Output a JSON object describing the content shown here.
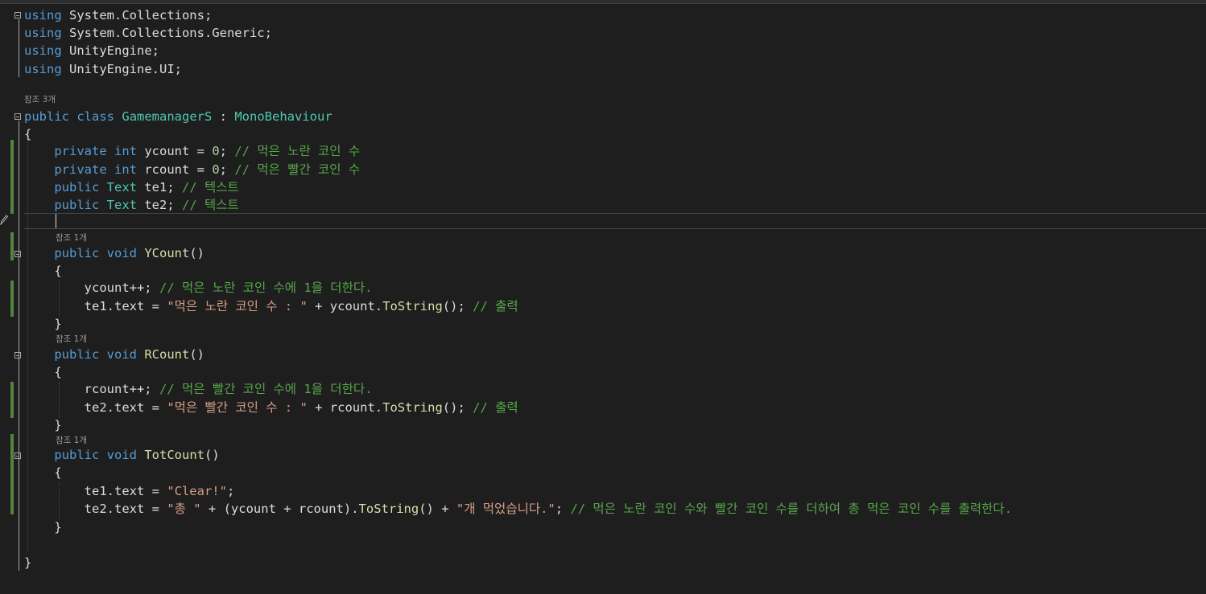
{
  "code": {
    "lines": [
      {
        "segments": [
          {
            "t": "using",
            "c": "kw"
          },
          {
            "t": " System.Collections;",
            "c": "pl"
          }
        ]
      },
      {
        "segments": [
          {
            "t": "using",
            "c": "kw"
          },
          {
            "t": " System.Collections.Generic;",
            "c": "pl"
          }
        ]
      },
      {
        "segments": [
          {
            "t": "using",
            "c": "kw"
          },
          {
            "t": " UnityEngine;",
            "c": "pl"
          }
        ]
      },
      {
        "segments": [
          {
            "t": "using",
            "c": "kw"
          },
          {
            "t": " UnityEngine.UI;",
            "c": "pl"
          }
        ]
      },
      {
        "segments": [
          {
            "t": "public",
            "c": "kw"
          },
          {
            "t": " ",
            "c": "pl"
          },
          {
            "t": "class",
            "c": "kw"
          },
          {
            "t": " ",
            "c": "pl"
          },
          {
            "t": "GamemanagerS",
            "c": "ty"
          },
          {
            "t": " : ",
            "c": "pl"
          },
          {
            "t": "MonoBehaviour",
            "c": "ty"
          }
        ]
      },
      {
        "segments": [
          {
            "t": "{",
            "c": "pl"
          }
        ]
      },
      {
        "segments": [
          {
            "t": "    ",
            "c": "pl"
          },
          {
            "t": "private",
            "c": "kw"
          },
          {
            "t": " ",
            "c": "pl"
          },
          {
            "t": "int",
            "c": "kw"
          },
          {
            "t": " ycount = ",
            "c": "pl"
          },
          {
            "t": "0",
            "c": "nu"
          },
          {
            "t": "; ",
            "c": "pl"
          },
          {
            "t": "// 먹은 노란 코인 수",
            "c": "cm"
          }
        ]
      },
      {
        "segments": [
          {
            "t": "    ",
            "c": "pl"
          },
          {
            "t": "private",
            "c": "kw"
          },
          {
            "t": " ",
            "c": "pl"
          },
          {
            "t": "int",
            "c": "kw"
          },
          {
            "t": " rcount = ",
            "c": "pl"
          },
          {
            "t": "0",
            "c": "nu"
          },
          {
            "t": "; ",
            "c": "pl"
          },
          {
            "t": "// 먹은 빨간 코인 수",
            "c": "cm"
          }
        ]
      },
      {
        "segments": [
          {
            "t": "    ",
            "c": "pl"
          },
          {
            "t": "public",
            "c": "kw"
          },
          {
            "t": " ",
            "c": "pl"
          },
          {
            "t": "Text",
            "c": "ty"
          },
          {
            "t": " te1; ",
            "c": "pl"
          },
          {
            "t": "// 텍스트",
            "c": "cm"
          }
        ]
      },
      {
        "segments": [
          {
            "t": "    ",
            "c": "pl"
          },
          {
            "t": "public",
            "c": "kw"
          },
          {
            "t": " ",
            "c": "pl"
          },
          {
            "t": "Text",
            "c": "ty"
          },
          {
            "t": " te2; ",
            "c": "pl"
          },
          {
            "t": "// 텍스트",
            "c": "cm"
          }
        ]
      },
      {
        "segments": [
          {
            "t": "",
            "c": "pl"
          }
        ]
      },
      {
        "segments": [
          {
            "t": "    ",
            "c": "pl"
          },
          {
            "t": "public",
            "c": "kw"
          },
          {
            "t": " ",
            "c": "pl"
          },
          {
            "t": "void",
            "c": "kw"
          },
          {
            "t": " ",
            "c": "pl"
          },
          {
            "t": "YCount",
            "c": "me"
          },
          {
            "t": "()",
            "c": "pl"
          }
        ]
      },
      {
        "segments": [
          {
            "t": "    {",
            "c": "pl"
          }
        ]
      },
      {
        "segments": [
          {
            "t": "        ycount++; ",
            "c": "pl"
          },
          {
            "t": "// 먹은 노란 코인 수에 1을 더한다.",
            "c": "cm"
          }
        ]
      },
      {
        "segments": [
          {
            "t": "        te1.text = ",
            "c": "pl"
          },
          {
            "t": "\"먹은 노란 코인 수 : \"",
            "c": "st"
          },
          {
            "t": " + ycount.",
            "c": "pl"
          },
          {
            "t": "ToString",
            "c": "me"
          },
          {
            "t": "(); ",
            "c": "pl"
          },
          {
            "t": "// 출력",
            "c": "cm"
          }
        ]
      },
      {
        "segments": [
          {
            "t": "    }",
            "c": "pl"
          }
        ]
      },
      {
        "segments": [
          {
            "t": "    ",
            "c": "pl"
          },
          {
            "t": "public",
            "c": "kw"
          },
          {
            "t": " ",
            "c": "pl"
          },
          {
            "t": "void",
            "c": "kw"
          },
          {
            "t": " ",
            "c": "pl"
          },
          {
            "t": "RCount",
            "c": "me"
          },
          {
            "t": "()",
            "c": "pl"
          }
        ]
      },
      {
        "segments": [
          {
            "t": "    {",
            "c": "pl"
          }
        ]
      },
      {
        "segments": [
          {
            "t": "        rcount++; ",
            "c": "pl"
          },
          {
            "t": "// 먹은 빨간 코인 수에 1을 더한다.",
            "c": "cm"
          }
        ]
      },
      {
        "segments": [
          {
            "t": "        te2.text = ",
            "c": "pl"
          },
          {
            "t": "\"먹은 빨간 코인 수 : \"",
            "c": "st"
          },
          {
            "t": " + rcount.",
            "c": "pl"
          },
          {
            "t": "ToString",
            "c": "me"
          },
          {
            "t": "(); ",
            "c": "pl"
          },
          {
            "t": "// 출력",
            "c": "cm"
          }
        ]
      },
      {
        "segments": [
          {
            "t": "    }",
            "c": "pl"
          }
        ]
      },
      {
        "segments": [
          {
            "t": "    ",
            "c": "pl"
          },
          {
            "t": "public",
            "c": "kw"
          },
          {
            "t": " ",
            "c": "pl"
          },
          {
            "t": "void",
            "c": "kw"
          },
          {
            "t": " ",
            "c": "pl"
          },
          {
            "t": "TotCount",
            "c": "me"
          },
          {
            "t": "()",
            "c": "pl"
          }
        ]
      },
      {
        "segments": [
          {
            "t": "    {",
            "c": "pl"
          }
        ]
      },
      {
        "segments": [
          {
            "t": "        te1.text = ",
            "c": "pl"
          },
          {
            "t": "\"Clear!\"",
            "c": "st"
          },
          {
            "t": ";",
            "c": "pl"
          }
        ]
      },
      {
        "segments": [
          {
            "t": "        te2.text = ",
            "c": "pl"
          },
          {
            "t": "\"총 \"",
            "c": "st"
          },
          {
            "t": " + (ycount + rcount).",
            "c": "pl"
          },
          {
            "t": "ToString",
            "c": "me"
          },
          {
            "t": "() + ",
            "c": "pl"
          },
          {
            "t": "\"개 먹었습니다.\"",
            "c": "st"
          },
          {
            "t": "; ",
            "c": "pl"
          },
          {
            "t": "// 먹은 노란 코인 수와 빨간 코인 수를 더하여 총 먹은 코인 수를 출력한다.",
            "c": "cm"
          }
        ]
      },
      {
        "segments": [
          {
            "t": "    }",
            "c": "pl"
          }
        ]
      },
      {
        "segments": [
          {
            "t": "",
            "c": "pl"
          }
        ]
      },
      {
        "segments": [
          {
            "t": "}",
            "c": "pl"
          }
        ]
      }
    ],
    "codelens": [
      "참조 3개",
      "참조 1개",
      "참조 1개",
      "참조 1개"
    ]
  },
  "icons": {
    "fold": "collapse-box-icon",
    "edit": "pencil-icon"
  },
  "colors": {
    "background": "#1e1e1e",
    "keyword": "#569cd6",
    "type": "#4ec9b0",
    "method": "#dcdcaa",
    "number": "#b5cea8",
    "string": "#d69d85",
    "comment": "#57a64a",
    "change_bar": "#53843f"
  }
}
